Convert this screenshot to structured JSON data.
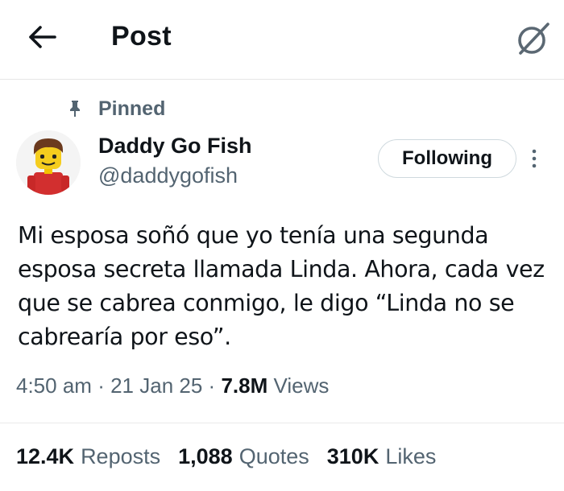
{
  "header": {
    "title": "Post",
    "back_icon": "arrow-left-icon",
    "grok_icon": "grok-icon"
  },
  "pinned": {
    "label": "Pinned",
    "icon": "pin-icon"
  },
  "author": {
    "display_name": "Daddy Go Fish",
    "handle": "@daddygofish",
    "avatar": "lego-figure-avatar"
  },
  "follow_button": {
    "label": "Following"
  },
  "tweet": {
    "text": "Mi esposa soñó que yo tenía una segunda esposa secreta llamada Linda. Ahora, cada vez que se cabrea conmigo, le digo “Linda no se cabrearía por eso”."
  },
  "meta": {
    "time": "4:50 am",
    "separator1": "·",
    "date": "21 Jan 25",
    "separator2": "·",
    "views_count": "7.8M",
    "views_label": "Views"
  },
  "stats": {
    "reposts_count": "12.4K",
    "reposts_label": "Reposts",
    "quotes_count": "1,088",
    "quotes_label": "Quotes",
    "likes_count": "310K",
    "likes_label": "Likes"
  },
  "colors": {
    "text_primary": "#0f1419",
    "text_secondary": "#536471",
    "border": "#cfd9de"
  }
}
